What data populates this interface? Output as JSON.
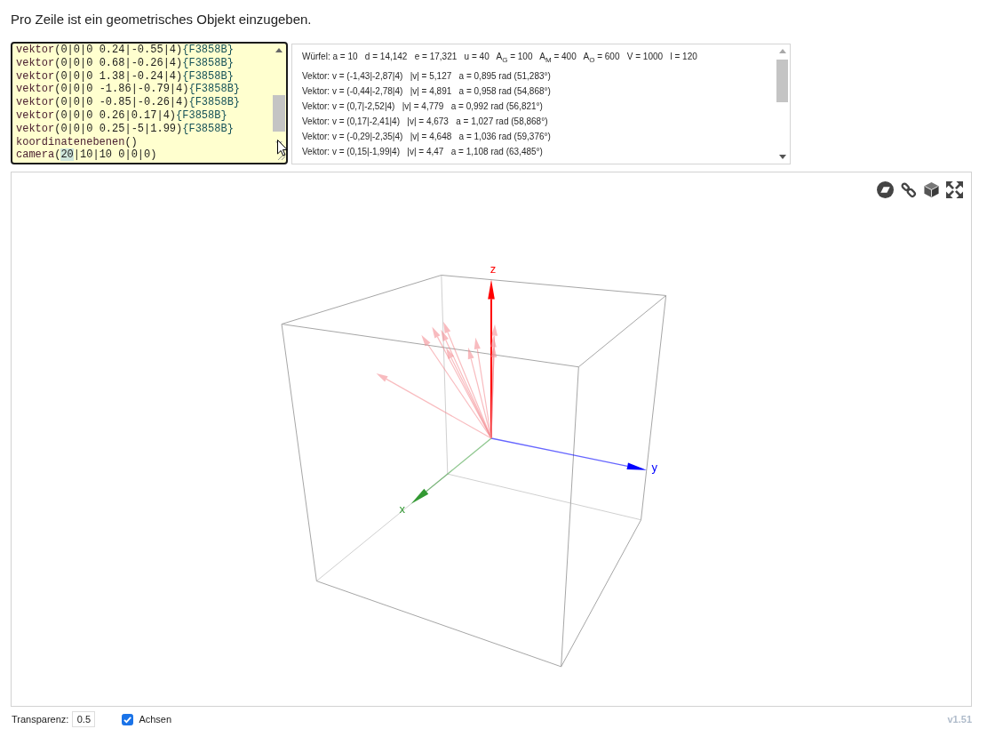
{
  "instruction": "Pro Zeile ist ein geometrisches Objekt einzugeben.",
  "editor": {
    "lines": [
      {
        "segments": [
          {
            "kind": "name",
            "text": "vektor"
          },
          {
            "kind": "args",
            "text": "(0|0|0 0.24|-0.55|4)"
          },
          {
            "kind": "color",
            "text": "{F3858B}"
          }
        ]
      },
      {
        "segments": [
          {
            "kind": "name",
            "text": "vektor"
          },
          {
            "kind": "args",
            "text": "(0|0|0 0.68|-0.26|4)"
          },
          {
            "kind": "color",
            "text": "{F3858B}"
          }
        ]
      },
      {
        "segments": [
          {
            "kind": "name",
            "text": "vektor"
          },
          {
            "kind": "args",
            "text": "(0|0|0 1.38|-0.24|4)"
          },
          {
            "kind": "color",
            "text": "{F3858B}"
          }
        ]
      },
      {
        "segments": [
          {
            "kind": "name",
            "text": "vektor"
          },
          {
            "kind": "args",
            "text": "(0|0|0 -1.86|-0.79|4)"
          },
          {
            "kind": "color",
            "text": "{F3858B}"
          }
        ]
      },
      {
        "segments": [
          {
            "kind": "name",
            "text": "vektor"
          },
          {
            "kind": "args",
            "text": "(0|0|0 -0.85|-0.26|4)"
          },
          {
            "kind": "color",
            "text": "{F3858B}"
          }
        ]
      },
      {
        "segments": [
          {
            "kind": "name",
            "text": "vektor"
          },
          {
            "kind": "args",
            "text": "(0|0|0 0.26|0.17|4)"
          },
          {
            "kind": "color",
            "text": "{F3858B}"
          }
        ]
      },
      {
        "segments": [
          {
            "kind": "name",
            "text": "vektor"
          },
          {
            "kind": "args",
            "text": "(0|0|0 0.25|-5|1.99)"
          },
          {
            "kind": "color",
            "text": "{F3858B}"
          }
        ]
      },
      {
        "segments": [
          {
            "kind": "name",
            "text": "koordinatenebenen"
          },
          {
            "kind": "args",
            "text": "()"
          }
        ]
      },
      {
        "segments": [
          {
            "kind": "name",
            "text": "camera"
          },
          {
            "kind": "args",
            "text": "("
          },
          {
            "kind": "match",
            "text": "20"
          },
          {
            "kind": "args",
            "text": "|10|10 0|0|0)"
          }
        ]
      }
    ]
  },
  "output": {
    "lines": [
      "Würfel: a = 10   d = 14,142   e = 17,321   u = 40   A$_{G}$ = 100   A$_{M}$ = 400   A$_{O}$ = 600   V = 1000   l = 120",
      "Vektor: v = (-1,43|-2,87|4)   |v| = 5,127   a = 0,895 rad (51,283°)",
      "Vektor: v = (-0,44|-2,78|4)   |v| = 4,891   a = 0,958 rad (54,868°)",
      "Vektor: v = (0,7|-2,52|4)   |v| = 4,779   a = 0,992 rad (56,821°)",
      "Vektor: v = (0,17|-2,41|4)   |v| = 4,673   a = 1,027 rad (58,868°)",
      "Vektor: v = (-0,29|-2,35|4)   |v| = 4,648   a = 1,036 rad (59,376°)",
      "Vektor: v = (0,15|-1,99|4)   |v| = 4,47   a = 1,108 rad (63,485°)"
    ]
  },
  "scene": {
    "axes": [
      {
        "kind": "z",
        "label": "z",
        "color": "#ff0000"
      },
      {
        "kind": "y",
        "label": "y",
        "color": "#0000ff"
      },
      {
        "kind": "x",
        "label": "x",
        "color": "#339933"
      }
    ]
  },
  "controls": {
    "transparency": {
      "label": "Transparenz:",
      "value": "0.5"
    },
    "axes_toggle": {
      "label": "Achsen",
      "checked": true
    }
  },
  "version": "v1.51"
}
